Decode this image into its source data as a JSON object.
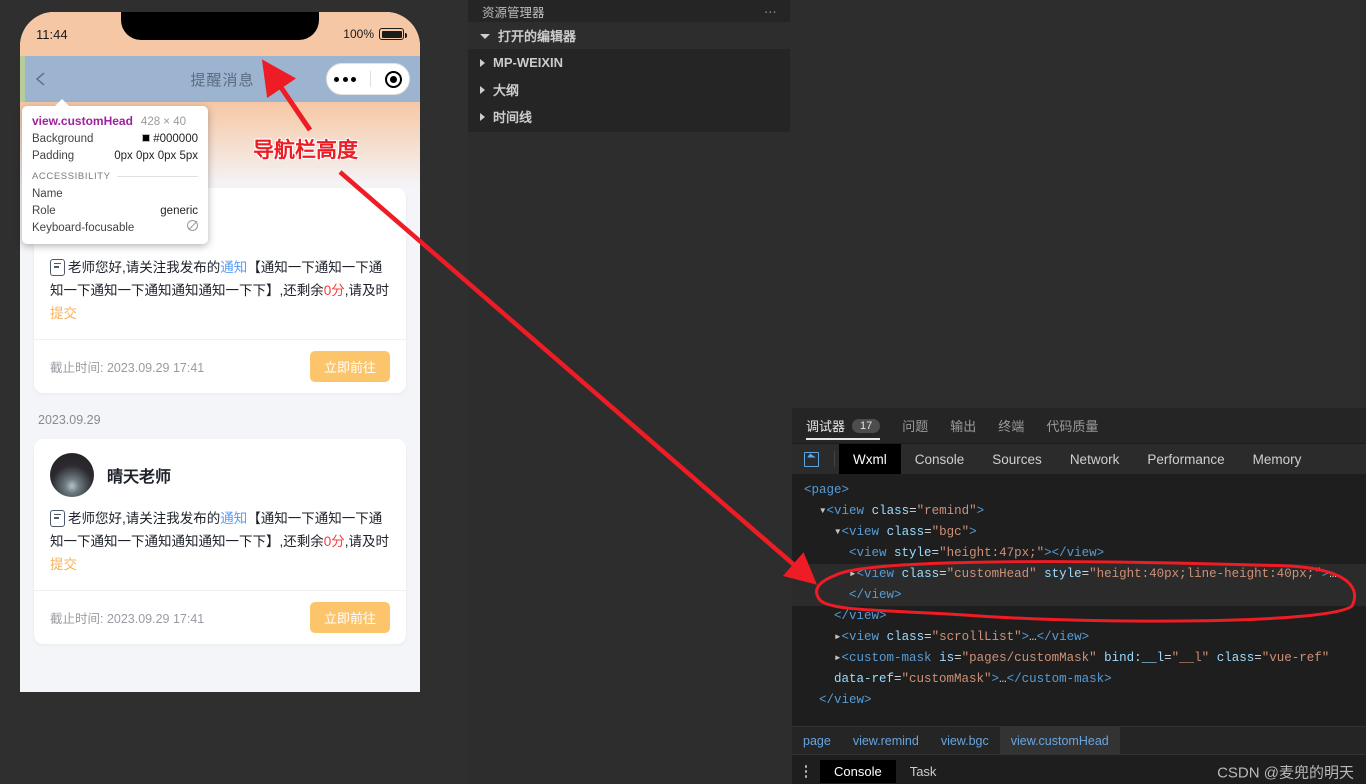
{
  "simulator": {
    "status_bar": {
      "time": "11:44",
      "battery_percent": "100%"
    },
    "nav": {
      "title": "提醒消息",
      "back_icon": "chevron-left-icon",
      "capsule_more_icon": "more-dots-icon",
      "capsule_target_icon": "target-circle-icon"
    },
    "inspector_tooltip": {
      "selector": "view.customHead",
      "dimensions": "428 × 40",
      "rows": [
        {
          "key": "Background",
          "value": "#000000",
          "swatch": "#000000"
        },
        {
          "key": "Padding",
          "value": "0px 0px 0px 5px"
        }
      ],
      "section_title": "ACCESSIBILITY",
      "a11y": [
        {
          "key": "Name",
          "value": ""
        },
        {
          "key": "Role",
          "value": "generic"
        },
        {
          "key": "Keyboard-focusable",
          "value": "no-icon"
        }
      ]
    },
    "messages": [
      {
        "date_label": "",
        "author": "",
        "show_author": false,
        "icon": "note-icon",
        "text_parts": [
          {
            "t": "老师您好,请关注我发布的",
            "c": "normal"
          },
          {
            "t": "通知",
            "c": "link"
          },
          {
            "t": "【通知一下通知一下通知一下通知一下通知通知通知一下下】,还剩余",
            "c": "normal"
          },
          {
            "t": "0分",
            "c": "red"
          },
          {
            "t": ",请及时",
            "c": "normal"
          },
          {
            "t": "提交",
            "c": "orange"
          }
        ],
        "deadline_label": "截止时间:",
        "deadline_value": "2023.09.29 17:41",
        "action_label": "立即前往"
      },
      {
        "date_label": "2023.09.29",
        "author": "晴天老师",
        "show_author": true,
        "icon": "note-icon",
        "text_parts": [
          {
            "t": "老师您好,请关注我发布的",
            "c": "normal"
          },
          {
            "t": "通知",
            "c": "link"
          },
          {
            "t": "【通知一下通知一下通知一下通知一下通知通知通知一下下】,还剩余",
            "c": "normal"
          },
          {
            "t": "0分",
            "c": "red"
          },
          {
            "t": ",请及时",
            "c": "normal"
          },
          {
            "t": "提交",
            "c": "orange"
          }
        ],
        "deadline_label": "截止时间:",
        "deadline_value": "2023.09.29 17:41",
        "action_label": "立即前往"
      }
    ]
  },
  "explorer": {
    "title": "资源管理器",
    "more_icon": "ellipsis-icon",
    "items": [
      {
        "label": "打开的编辑器",
        "expanded": true
      },
      {
        "label": "MP-WEIXIN",
        "expanded": false
      },
      {
        "label": "大纲",
        "expanded": false
      },
      {
        "label": "时间线",
        "expanded": false
      }
    ]
  },
  "devtools": {
    "panel_tabs": [
      {
        "label": "调试器",
        "badge": "17",
        "active": true
      },
      {
        "label": "问题",
        "badge": "",
        "active": false
      },
      {
        "label": "输出",
        "badge": "",
        "active": false
      },
      {
        "label": "终端",
        "badge": "",
        "active": false
      },
      {
        "label": "代码质量",
        "badge": "",
        "active": false
      }
    ],
    "inspect_icon": "select-element-icon",
    "sub_tabs": [
      {
        "label": "Wxml",
        "active": true
      },
      {
        "label": "Console",
        "active": false
      },
      {
        "label": "Sources",
        "active": false
      },
      {
        "label": "Network",
        "active": false
      },
      {
        "label": "Performance",
        "active": false
      },
      {
        "label": "Memory",
        "active": false
      }
    ],
    "dom_lines": [
      {
        "indent": 0,
        "twisty": "",
        "html": "<span class=\"tag\">&lt;page&gt;</span>",
        "selected": false
      },
      {
        "indent": 1,
        "twisty": "open",
        "html": "<span class=\"tag\">&lt;view</span> <span class=\"attr\">class</span><span class=\"plain\">=</span><span class=\"val\">\"remind\"</span><span class=\"tag\">&gt;</span>",
        "selected": false
      },
      {
        "indent": 2,
        "twisty": "open",
        "html": "<span class=\"tag\">&lt;view</span> <span class=\"attr\">class</span><span class=\"plain\">=</span><span class=\"val\">\"bgc\"</span><span class=\"tag\">&gt;</span>",
        "selected": false
      },
      {
        "indent": 3,
        "twisty": "",
        "html": "<span class=\"tag\">&lt;view</span> <span class=\"attr\">style</span><span class=\"plain\">=</span><span class=\"val\">\"height:47px;\"</span><span class=\"tag\">&gt;&lt;/view&gt;</span>",
        "selected": false
      },
      {
        "indent": 3,
        "twisty": "closed",
        "html": "<span class=\"tag\">&lt;view</span> <span class=\"attr\">class</span><span class=\"plain\">=</span><span class=\"val\">\"customHead\"</span> <span class=\"attr\">style</span><span class=\"plain\">=</span><span class=\"val\">\"height:40px;line-height:40px;\"</span><span class=\"tag\">&gt;</span><span class=\"plain\">…</span><span class=\"tag\">&lt;/view&gt;</span>",
        "selected": true
      },
      {
        "indent": 2,
        "twisty": "",
        "html": "<span class=\"tag\">&lt;/view&gt;</span>",
        "selected": false
      },
      {
        "indent": 2,
        "twisty": "closed",
        "html": "<span class=\"tag\">&lt;view</span> <span class=\"attr\">class</span><span class=\"plain\">=</span><span class=\"val\">\"scrollList\"</span><span class=\"tag\">&gt;</span><span class=\"plain\">…</span><span class=\"tag\">&lt;/view&gt;</span>",
        "selected": false
      },
      {
        "indent": 2,
        "twisty": "closed",
        "html": "<span class=\"tag\">&lt;custom-mask</span> <span class=\"attr\">is</span><span class=\"plain\">=</span><span class=\"val\">\"pages/customMask\"</span> <span class=\"attr\">bind:__l</span><span class=\"plain\">=</span><span class=\"val\">\"__l\"</span> <span class=\"attr\">class</span><span class=\"plain\">=</span><span class=\"val\">\"vue-ref\"</span> <span class=\"attr\">data-ref</span><span class=\"plain\">=</span><span class=\"val\">\"customMask\"</span><span class=\"tag\">&gt;</span><span class=\"plain\">…</span><span class=\"tag\">&lt;/custom-mask&gt;</span>",
        "selected": false
      },
      {
        "indent": 1,
        "twisty": "",
        "html": "<span class=\"tag\">&lt;/view&gt;</span>",
        "selected": false
      }
    ],
    "breadcrumb": [
      {
        "label": "page",
        "active": false
      },
      {
        "label": "view.remind",
        "active": false
      },
      {
        "label": "view.bgc",
        "active": false
      },
      {
        "label": "view.customHead",
        "active": true
      }
    ],
    "bottom_tabs": [
      {
        "label": "Console",
        "active": true
      },
      {
        "label": "Task",
        "active": false
      }
    ],
    "kebab_icon": "kebab-menu-icon",
    "watermark": "CSDN @麦兜的明天"
  },
  "annotation": {
    "label": "导航栏高度",
    "arrow_color": "#ee1c25"
  }
}
